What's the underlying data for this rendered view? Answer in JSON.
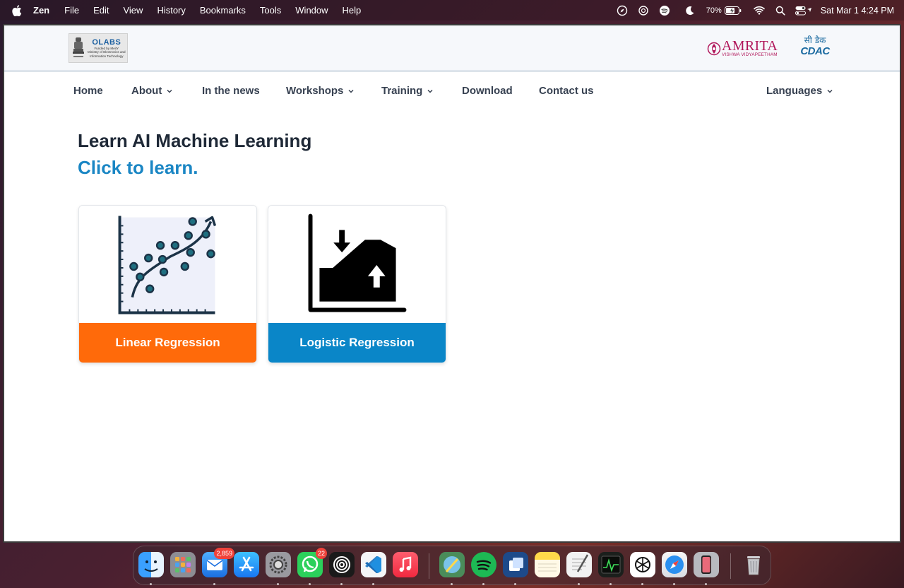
{
  "menubar": {
    "app_name": "Zen",
    "items": [
      "File",
      "Edit",
      "View",
      "History",
      "Bookmarks",
      "Tools",
      "Window",
      "Help"
    ],
    "battery": "70%",
    "clock": "Sat Mar 1  4:24 PM"
  },
  "header": {
    "olabs": {
      "name": "OLABS",
      "line1": "Funded by MeitY",
      "line2": "Ministry of Electronics and",
      "line3": "Information Technology"
    },
    "amrita": {
      "name": "AMRITA",
      "sub": "VISHWA VIDYAPEETHAM"
    },
    "cdac": {
      "hindi": "सी डैक",
      "name": "CDAC"
    }
  },
  "nav": {
    "home": "Home",
    "about": "About",
    "news": "In the news",
    "workshops": "Workshops",
    "training": "Training",
    "download": "Download",
    "contact": "Contact us",
    "languages": "Languages"
  },
  "content": {
    "title": "Learn AI Machine Learning",
    "subtitle": "Click to learn.",
    "cards": [
      {
        "label": "Linear Regression",
        "color": "#ff6a0a"
      },
      {
        "label": "Logistic Regression",
        "color": "#0a86c8"
      }
    ]
  },
  "dock": {
    "mail_badge": "2,859",
    "whatsapp_badge": "22"
  }
}
